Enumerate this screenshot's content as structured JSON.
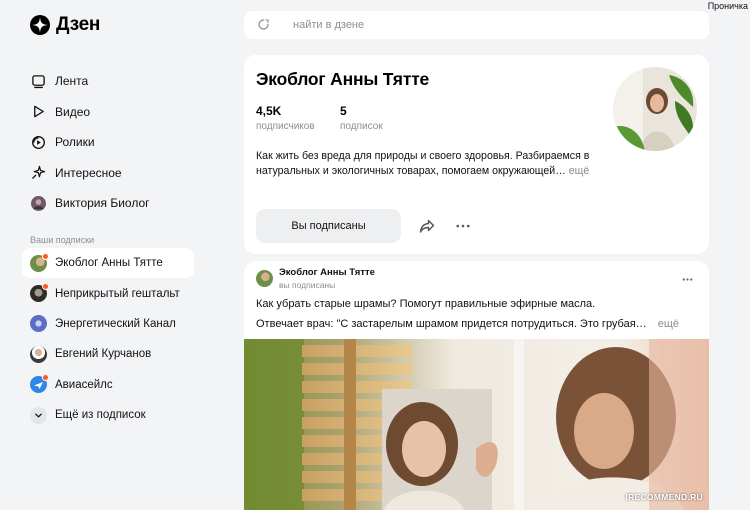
{
  "app": {
    "logo_text": "Дзен",
    "username": "Проничка",
    "accent_color": "#ff5a1f"
  },
  "search": {
    "placeholder": "найти в дзене",
    "icon": "search-icon"
  },
  "nav": {
    "items": [
      {
        "label": "Лента",
        "icon": "feed-icon"
      },
      {
        "label": "Видео",
        "icon": "play-icon"
      },
      {
        "label": "Ролики",
        "icon": "shorts-icon"
      },
      {
        "label": "Интересное",
        "icon": "sparkle-icon"
      },
      {
        "label": "Виктория Биолог",
        "icon": "avatar"
      }
    ]
  },
  "subscriptions": {
    "heading": "Ваши подписки",
    "items": [
      {
        "label": "Экоблог Анны Тятте",
        "active": true,
        "new": true
      },
      {
        "label": "Неприкрытый гештальт",
        "new": true
      },
      {
        "label": "Энергетический Канал"
      },
      {
        "label": "Евгений Курчанов"
      },
      {
        "label": "Авиасейлс",
        "new": true
      }
    ],
    "more_label": "Ещё из подписок"
  },
  "channel": {
    "title": "Экоблог Анны Тятте",
    "subscribers_count": "4,5K",
    "subscribers_label": "подписчиков",
    "subscriptions_count": "5",
    "subscriptions_label": "подписок",
    "description": "Как жить без вреда для природы и своего здоровья. Разбираемся в натуральных и экологичных товарах, помогаем окружающей…",
    "description_more": "ещё",
    "subscribe_button": "Вы подписаны"
  },
  "post": {
    "author": "Экоблог Анны Тятте",
    "author_status": "вы подписаны",
    "title": "Как убрать старые шрамы? Помогут правильные эфирные масла.",
    "snippet": "Отвечает врач: \"С застарелым шрамом придется потрудиться. Это грубая…",
    "snippet_more": "ещё"
  },
  "watermark": "IRECOMMEND.RU"
}
